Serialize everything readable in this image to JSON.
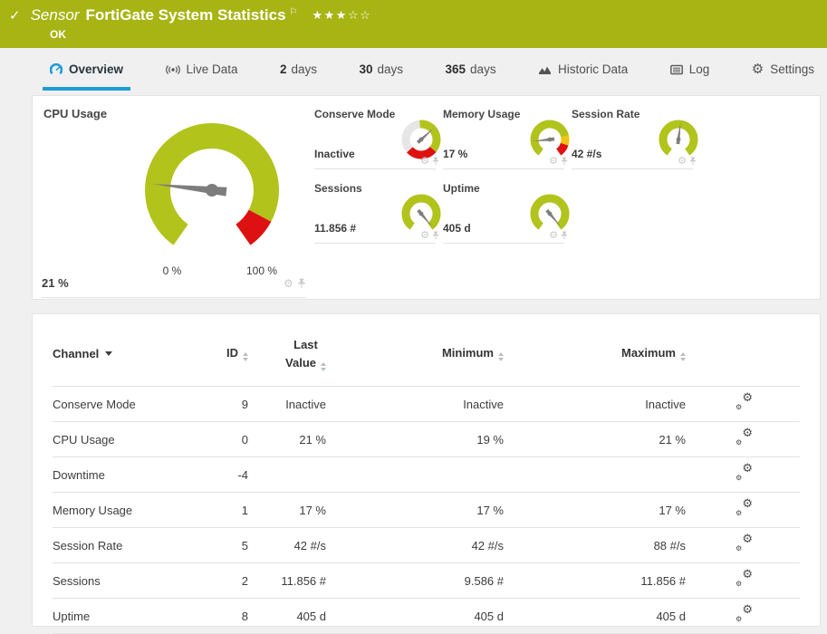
{
  "banner": {
    "check": "✓",
    "kind": "Sensor",
    "title": "FortiGate System Statistics",
    "flag": "⚐",
    "stars": "★★★☆☆",
    "status": "OK"
  },
  "tabs": [
    {
      "label": "Overview"
    },
    {
      "label": "Live Data"
    },
    {
      "num": "2",
      "label": "days"
    },
    {
      "num": "30",
      "label": "days"
    },
    {
      "num": "365",
      "label": "days"
    },
    {
      "label": "Historic Data"
    },
    {
      "label": "Log"
    },
    {
      "label": "Settings"
    }
  ],
  "colors": {
    "banner": "#a7b414",
    "green": "#b2c31c",
    "red": "#dd1111",
    "yellow": "#f2c50f",
    "track": "#e6e6e6",
    "needle": "#7d7d7d",
    "accent": "#1e9cd7"
  },
  "gauges": {
    "cpu": {
      "title": "CPU Usage",
      "value": "21 %",
      "scale_min": "0 %",
      "scale_max": "100 %",
      "needle_deg": -84,
      "segments": [
        {
          "color": "green",
          "from": -145,
          "to": 118
        },
        {
          "color": "red",
          "from": 118,
          "to": 145
        }
      ]
    },
    "minis": [
      {
        "title": "Conserve Mode",
        "value": "Inactive",
        "needle_deg": 48,
        "segments": [
          {
            "color": "track",
            "from": 228,
            "to": 355
          },
          {
            "color": "green",
            "from": -5,
            "to": 130
          },
          {
            "color": "red",
            "from": 130,
            "to": 228
          }
        ]
      },
      {
        "title": "Memory Usage",
        "value": "17 %",
        "needle_deg": -96,
        "segments": [
          {
            "color": "green",
            "from": -145,
            "to": 78
          },
          {
            "color": "yellow",
            "from": 78,
            "to": 108
          },
          {
            "color": "red",
            "from": 108,
            "to": 145
          }
        ]
      },
      {
        "title": "Session Rate",
        "value": "42 #/s",
        "needle_deg": 7,
        "segments": [
          {
            "color": "green",
            "from": -145,
            "to": 145
          }
        ]
      },
      {
        "title": "Sessions",
        "value": "11.856 #",
        "needle_deg": 140,
        "segments": [
          {
            "color": "green",
            "from": -145,
            "to": 145
          }
        ]
      },
      {
        "title": "Uptime",
        "value": "405 d",
        "needle_deg": 140,
        "segments": [
          {
            "color": "green",
            "from": -145,
            "to": 145
          }
        ]
      }
    ]
  },
  "table": {
    "headers": {
      "channel": "Channel",
      "id": "ID",
      "last1": "Last",
      "last2": "Value",
      "min": "Minimum",
      "max": "Maximum"
    },
    "rows": [
      {
        "channel": "Conserve Mode",
        "id": "9",
        "last": "Inactive",
        "min": "Inactive",
        "max": "Inactive"
      },
      {
        "channel": "CPU Usage",
        "id": "0",
        "last": "21 %",
        "min": "19 %",
        "max": "21 %"
      },
      {
        "channel": "Downtime",
        "id": "-4",
        "last": "",
        "min": "",
        "max": ""
      },
      {
        "channel": "Memory Usage",
        "id": "1",
        "last": "17 %",
        "min": "17 %",
        "max": "17 %"
      },
      {
        "channel": "Session Rate",
        "id": "5",
        "last": "42 #/s",
        "min": "42 #/s",
        "max": "88 #/s"
      },
      {
        "channel": "Sessions",
        "id": "2",
        "last": "11.856 #",
        "min": "9.586 #",
        "max": "11.856 #"
      },
      {
        "channel": "Uptime",
        "id": "8",
        "last": "405 d",
        "min": "405 d",
        "max": "405 d"
      }
    ]
  },
  "chart_data": [
    {
      "type": "gauge",
      "title": "CPU Usage",
      "value": "21 %",
      "scale": [
        "0 %",
        "100 %"
      ]
    },
    {
      "type": "gauge",
      "title": "Conserve Mode",
      "value": "Inactive"
    },
    {
      "type": "gauge",
      "title": "Memory Usage",
      "value": "17 %"
    },
    {
      "type": "gauge",
      "title": "Session Rate",
      "value": "42 #/s"
    },
    {
      "type": "gauge",
      "title": "Sessions",
      "value": "11.856 #"
    },
    {
      "type": "gauge",
      "title": "Uptime",
      "value": "405 d"
    }
  ]
}
